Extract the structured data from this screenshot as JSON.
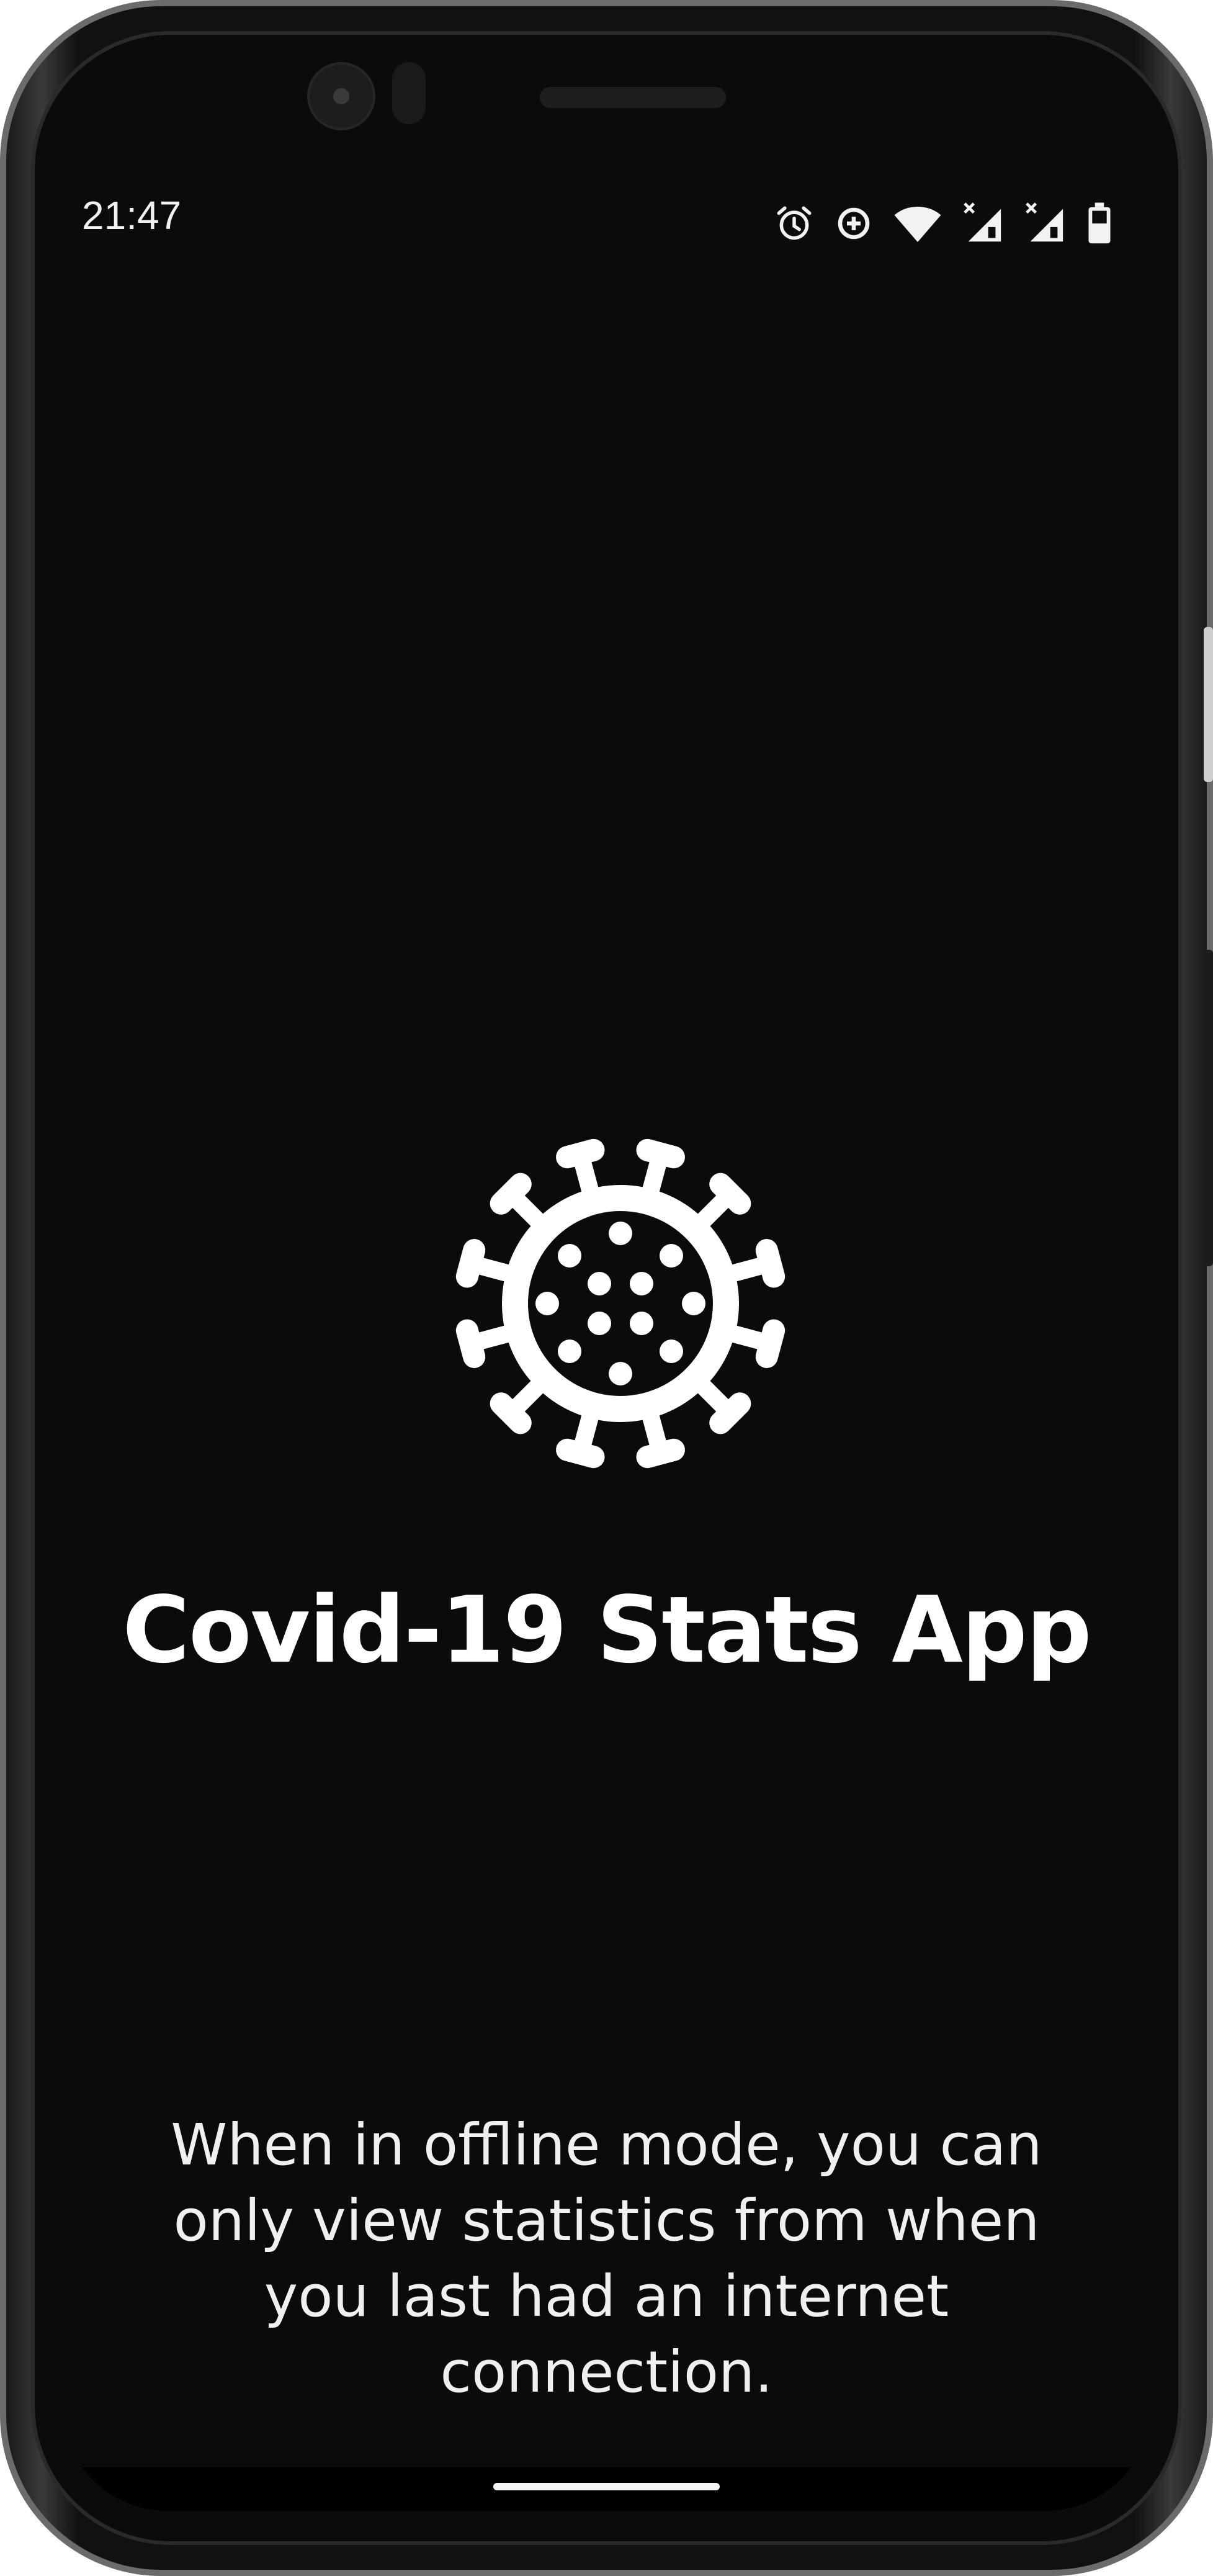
{
  "status_bar": {
    "time": "21:47",
    "icons": [
      "alarm-icon",
      "data-saver-icon",
      "wifi-icon",
      "signal-icon",
      "signal-icon",
      "battery-icon"
    ]
  },
  "app": {
    "logo_icon": "virus-icon",
    "title": "Covid-19 Stats App",
    "offline_notice": "When in offline mode, you can only view statistics from when you last had an internet connection."
  },
  "colors": {
    "background": "#0b0b0b",
    "text": "#ffffff",
    "accent": "#ffffff"
  }
}
